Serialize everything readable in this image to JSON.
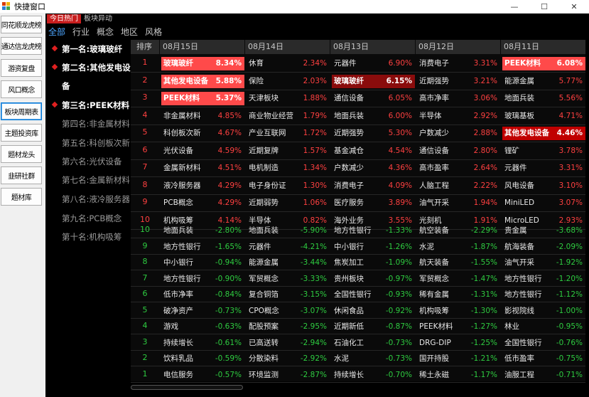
{
  "window": {
    "title": "快捷窗口",
    "minimize": "—",
    "maximize": "☐",
    "close": "✕"
  },
  "nav": [
    "同花顺龙虎榜",
    "通达信龙虎榜",
    "游资复盘",
    "风口概念",
    "板块周期表",
    "主题投资库",
    "题材龙头",
    "韭研社群",
    "题材库"
  ],
  "nav_active_index": 4,
  "tabs": {
    "top": [
      "今日热门",
      "板块异动"
    ],
    "sub": [
      "全部",
      "行业",
      "概念",
      "地区",
      "风格"
    ]
  },
  "ranking": [
    "第一名:玻璃玻纤",
    "第二名:其他发电设",
    "备",
    "第三名:PEEK材料",
    "第四名:非金属材料",
    "第五名:科创板次新",
    "第六名:光伏设备",
    "第七名:金属新材料",
    "第八名:液冷服务器",
    "第九名:PCB概念",
    "第十名:机构吸筹"
  ],
  "table": {
    "index_header": "排序",
    "dates": [
      "08月15日",
      "08月14日",
      "08月13日",
      "08月12日",
      "08月11日"
    ],
    "index_values": [
      "1",
      "2",
      "3",
      "4",
      "5",
      "6",
      "7",
      "8",
      "9",
      "10",
      "10",
      "9",
      "8",
      "7",
      "6",
      "5",
      "4",
      "3",
      "2",
      "1"
    ],
    "columns": [
      [
        [
          "玻璃玻纤",
          "8.34%"
        ],
        [
          "其他发电设备",
          "5.88%"
        ],
        [
          "PEEK材料",
          "5.37%"
        ],
        [
          "非金属材料",
          "4.85%"
        ],
        [
          "科创板次新",
          "4.67%"
        ],
        [
          "光伏设备",
          "4.59%"
        ],
        [
          "金属新材料",
          "4.51%"
        ],
        [
          "液冷服务器",
          "4.29%"
        ],
        [
          "PCB概念",
          "4.29%"
        ],
        [
          "机构吸筹",
          "4.14%"
        ],
        [
          "地面兵装",
          "-2.80%"
        ],
        [
          "地方性银行",
          "-1.65%"
        ],
        [
          "中小银行",
          "-0.94%"
        ],
        [
          "地方性银行",
          "-0.90%"
        ],
        [
          "低市净率",
          "-0.84%"
        ],
        [
          "破净资产",
          "-0.73%"
        ],
        [
          "游戏",
          "-0.63%"
        ],
        [
          "持续增长",
          "-0.61%"
        ],
        [
          "饮料乳品",
          "-0.59%"
        ],
        [
          "电信服务",
          "-0.57%"
        ]
      ],
      [
        [
          "休育",
          "2.34%"
        ],
        [
          "保险",
          "2.03%"
        ],
        [
          "天津板块",
          "1.88%"
        ],
        [
          "商业物业经营",
          "1.79%"
        ],
        [
          "产业互联网",
          "1.72%"
        ],
        [
          "近期复牌",
          "1.57%"
        ],
        [
          "电机制造",
          "1.34%"
        ],
        [
          "电子身份证",
          "1.30%"
        ],
        [
          "近期弱势",
          "1.06%"
        ],
        [
          "半导体",
          "0.82%"
        ],
        [
          "地面兵装",
          "-5.90%"
        ],
        [
          "元器件",
          "-4.21%"
        ],
        [
          "能源金属",
          "-3.44%"
        ],
        [
          "军贸概念",
          "-3.33%"
        ],
        [
          "复合铜箔",
          "-3.15%"
        ],
        [
          "CPO概念",
          "-3.07%"
        ],
        [
          "配股预案",
          "-2.95%"
        ],
        [
          "已高送转",
          "-2.94%"
        ],
        [
          "分散染料",
          "-2.92%"
        ],
        [
          "环境监测",
          "-2.87%"
        ]
      ],
      [
        [
          "元器件",
          "6.90%"
        ],
        [
          "玻璃玻纤",
          "6.15%"
        ],
        [
          "通信设备",
          "6.05%"
        ],
        [
          "地面兵装",
          "6.00%"
        ],
        [
          "近期强势",
          "5.30%"
        ],
        [
          "基金减仓",
          "4.54%"
        ],
        [
          "户数减少",
          "4.36%"
        ],
        [
          "消费电子",
          "4.09%"
        ],
        [
          "医疗服务",
          "3.89%"
        ],
        [
          "海外业务",
          "3.55%"
        ],
        [
          "地方性银行",
          "-1.33%"
        ],
        [
          "中小银行",
          "-1.26%"
        ],
        [
          "焦炭加工",
          "-1.09%"
        ],
        [
          "贵州板块",
          "-0.97%"
        ],
        [
          "全国性银行",
          "-0.93%"
        ],
        [
          "休闲食品",
          "-0.92%"
        ],
        [
          "近期新低",
          "-0.87%"
        ],
        [
          "石油化工",
          "-0.73%"
        ],
        [
          "水泥",
          "-0.73%"
        ],
        [
          "持续增长",
          "-0.70%"
        ]
      ],
      [
        [
          "消费电子",
          "3.31%"
        ],
        [
          "近期强势",
          "3.21%"
        ],
        [
          "高市净率",
          "3.06%"
        ],
        [
          "半导体",
          "2.92%"
        ],
        [
          "户数减少",
          "2.88%"
        ],
        [
          "通信设备",
          "2.80%"
        ],
        [
          "高市盈率",
          "2.64%"
        ],
        [
          "人脑工程",
          "2.22%"
        ],
        [
          "油气开采",
          "1.94%"
        ],
        [
          "光刻机",
          "1.91%"
        ],
        [
          "航空装备",
          "-2.29%"
        ],
        [
          "水泥",
          "-1.87%"
        ],
        [
          "航天装备",
          "-1.55%"
        ],
        [
          "军贸概念",
          "-1.47%"
        ],
        [
          "稀有金属",
          "-1.31%"
        ],
        [
          "机构吸筹",
          "-1.30%"
        ],
        [
          "PEEK材料",
          "-1.27%"
        ],
        [
          "DRG-DIP",
          "-1.25%"
        ],
        [
          "国开持股",
          "-1.21%"
        ],
        [
          "稀土永磁",
          "-1.17%"
        ]
      ],
      [
        [
          "PEEK材料",
          "6.08%"
        ],
        [
          "能源金属",
          "5.77%"
        ],
        [
          "地面兵装",
          "5.56%"
        ],
        [
          "玻璃基板",
          "4.71%"
        ],
        [
          "其他发电设备",
          "4.46%"
        ],
        [
          "锂矿",
          "3.78%"
        ],
        [
          "元器件",
          "3.31%"
        ],
        [
          "风电设备",
          "3.10%"
        ],
        [
          "MiniLED",
          "3.07%"
        ],
        [
          "MicroLED",
          "2.93%"
        ],
        [
          "贵金属",
          "-3.68%"
        ],
        [
          "航海装备",
          "-2.09%"
        ],
        [
          "油气开采",
          "-1.92%"
        ],
        [
          "地方性银行",
          "-1.20%"
        ],
        [
          "地方性银行",
          "-1.12%"
        ],
        [
          "影视院线",
          "-1.00%"
        ],
        [
          "林业",
          "-0.95%"
        ],
        [
          "全国性银行",
          "-0.76%"
        ],
        [
          "低市盈率",
          "-0.75%"
        ],
        [
          "油服工程",
          "-0.71%"
        ]
      ]
    ],
    "highlights": {
      "0": {
        "0": "hl1",
        "1": "hl1",
        "2": "hl1"
      },
      "2": {
        "1": "hl3"
      },
      "4": {
        "0": "hl1",
        "4": "hl2"
      }
    }
  },
  "colors": {
    "up": "#ff4040",
    "down": "#2ecc40",
    "tab_active": "#c81e1e",
    "subtab_active": "#4da6ff"
  }
}
